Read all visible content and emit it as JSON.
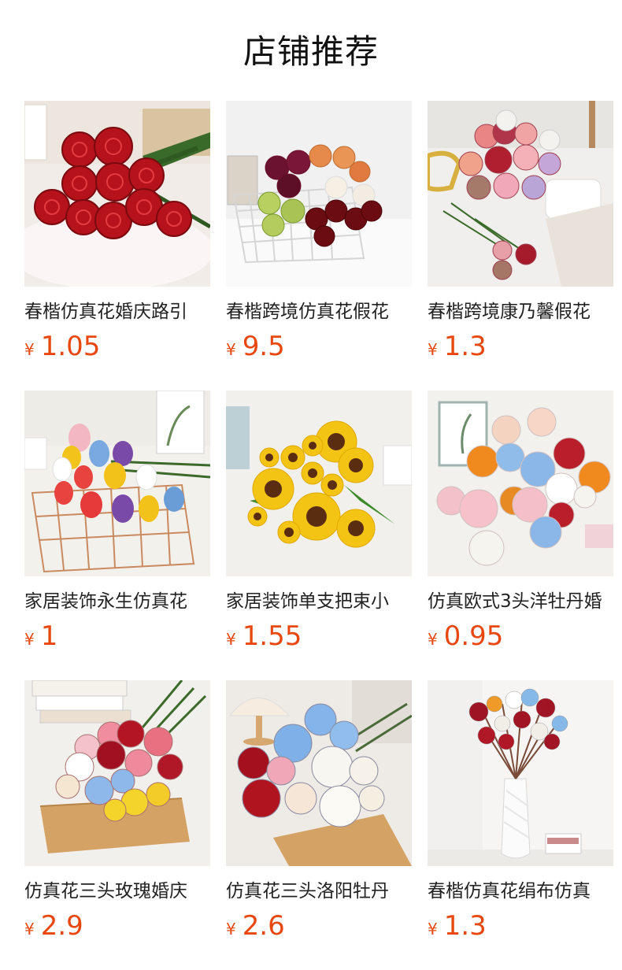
{
  "header": {
    "title": "店铺推荐"
  },
  "products": [
    {
      "name": "春楷仿真花婚庆路引",
      "currency": "¥",
      "price": "1.05",
      "image_icon": "red-roses-bouquet-image"
    },
    {
      "name": "春楷跨境仿真花假花",
      "currency": "¥",
      "price": "9.5",
      "image_icon": "rose-basket-image"
    },
    {
      "name": "春楷跨境康乃馨假花",
      "currency": "¥",
      "price": "1.3",
      "image_icon": "carnation-bouquet-image"
    },
    {
      "name": "家居装饰永生仿真花",
      "currency": "¥",
      "price": "1",
      "image_icon": "tulip-basket-image"
    },
    {
      "name": "家居装饰单支把束小",
      "currency": "¥",
      "price": "1.55",
      "image_icon": "sunflower-bouquet-image"
    },
    {
      "name": "仿真欧式3头洋牡丹婚",
      "currency": "¥",
      "price": "0.95",
      "image_icon": "peony-bouquet-image"
    },
    {
      "name": "仿真花三头玫瑰婚庆",
      "currency": "¥",
      "price": "2.9",
      "image_icon": "mixed-roses-tray-image"
    },
    {
      "name": "仿真花三头洛阳牡丹",
      "currency": "¥",
      "price": "2.6",
      "image_icon": "blue-peony-bouquet-image"
    },
    {
      "name": "春楷仿真花绢布仿真",
      "currency": "¥",
      "price": "1.3",
      "image_icon": "ball-flowers-vase-image"
    }
  ],
  "colors": {
    "price": "#e8480f",
    "title": "#111111",
    "text": "#222222"
  }
}
